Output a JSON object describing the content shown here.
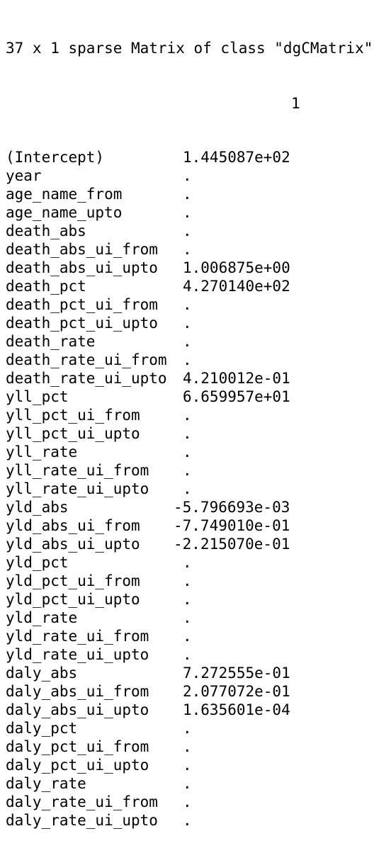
{
  "console": {
    "header": "37 x 1 sparse Matrix of class \"dgCMatrix\"",
    "column_header": "1",
    "rows": [
      {
        "name": "(Intercept)",
        "value": "1.445087e+02"
      },
      {
        "name": "year",
        "value": "."
      },
      {
        "name": "age_name_from",
        "value": "."
      },
      {
        "name": "age_name_upto",
        "value": "."
      },
      {
        "name": "death_abs",
        "value": "."
      },
      {
        "name": "death_abs_ui_from",
        "value": "."
      },
      {
        "name": "death_abs_ui_upto",
        "value": "1.006875e+00"
      },
      {
        "name": "death_pct",
        "value": "4.270140e+02"
      },
      {
        "name": "death_pct_ui_from",
        "value": "."
      },
      {
        "name": "death_pct_ui_upto",
        "value": "."
      },
      {
        "name": "death_rate",
        "value": "."
      },
      {
        "name": "death_rate_ui_from",
        "value": "."
      },
      {
        "name": "death_rate_ui_upto",
        "value": "4.210012e-01"
      },
      {
        "name": "yll_pct",
        "value": "6.659957e+01"
      },
      {
        "name": "yll_pct_ui_from",
        "value": "."
      },
      {
        "name": "yll_pct_ui_upto",
        "value": "."
      },
      {
        "name": "yll_rate",
        "value": "."
      },
      {
        "name": "yll_rate_ui_from",
        "value": "."
      },
      {
        "name": "yll_rate_ui_upto",
        "value": "."
      },
      {
        "name": "yld_abs",
        "value": "-5.796693e-03"
      },
      {
        "name": "yld_abs_ui_from",
        "value": "-7.749010e-01"
      },
      {
        "name": "yld_abs_ui_upto",
        "value": "-2.215070e-01"
      },
      {
        "name": "yld_pct",
        "value": "."
      },
      {
        "name": "yld_pct_ui_from",
        "value": "."
      },
      {
        "name": "yld_pct_ui_upto",
        "value": "."
      },
      {
        "name": "yld_rate",
        "value": "."
      },
      {
        "name": "yld_rate_ui_from",
        "value": "."
      },
      {
        "name": "yld_rate_ui_upto",
        "value": "."
      },
      {
        "name": "daly_abs",
        "value": "7.272555e-01"
      },
      {
        "name": "daly_abs_ui_from",
        "value": "2.077072e-01"
      },
      {
        "name": "daly_abs_ui_upto",
        "value": "1.635601e-04"
      },
      {
        "name": "daly_pct",
        "value": "."
      },
      {
        "name": "daly_pct_ui_from",
        "value": "."
      },
      {
        "name": "daly_pct_ui_upto",
        "value": "."
      },
      {
        "name": "daly_rate",
        "value": "."
      },
      {
        "name": "daly_rate_ui_from",
        "value": "."
      },
      {
        "name": "daly_rate_ui_upto",
        "value": "."
      }
    ]
  }
}
